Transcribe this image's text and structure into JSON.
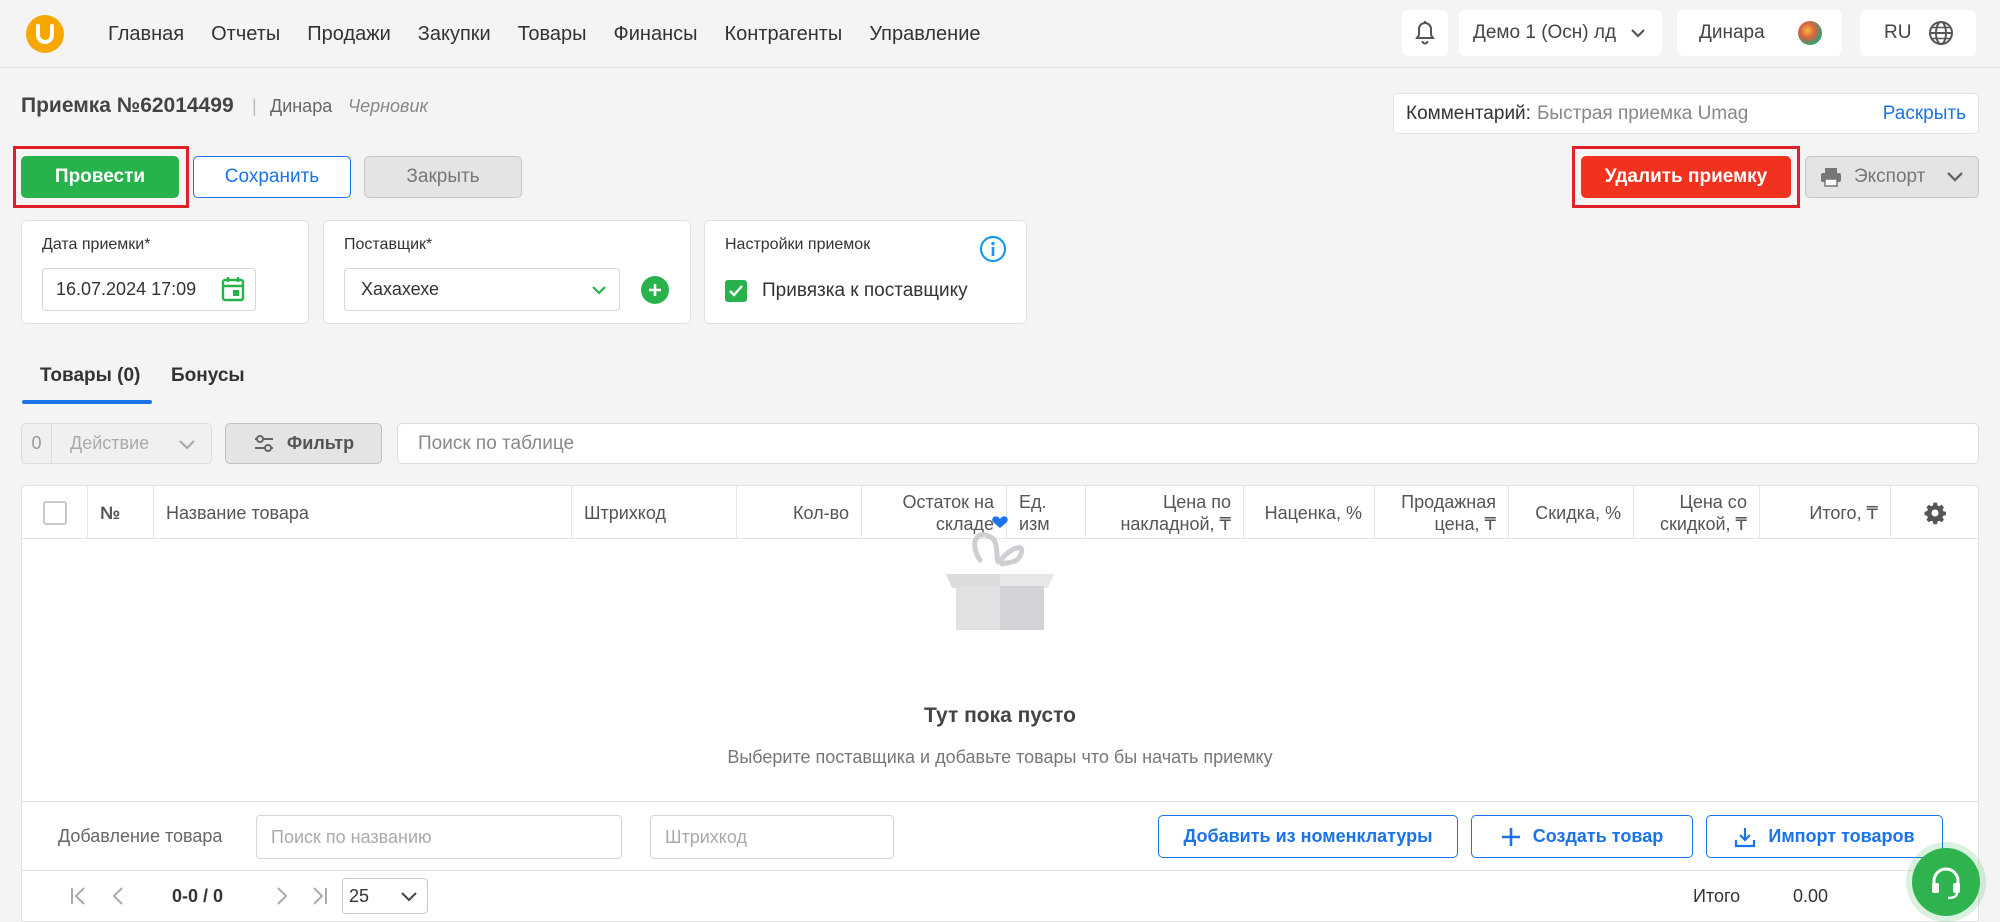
{
  "nav": {
    "items": [
      "Главная",
      "Отчеты",
      "Продажи",
      "Закупки",
      "Товары",
      "Финансы",
      "Контрагенты",
      "Управление"
    ],
    "store": "Демо 1 (Осн) лд",
    "user": "Динара",
    "language": "RU"
  },
  "header": {
    "title": "Приемка №62014499",
    "separator": "|",
    "author": "Динара",
    "status": "Черновик",
    "comment_label": "Комментарий:",
    "comment_value": "Быстрая приемка Umag",
    "comment_expand": "Раскрыть"
  },
  "actions": {
    "post": "Провести",
    "save": "Сохранить",
    "close": "Закрыть",
    "delete": "Удалить приемку",
    "export": "Экспорт"
  },
  "form": {
    "date_label": "Дата приемки*",
    "date_value": "16.07.2024 17:09",
    "supplier_label": "Поставщик*",
    "supplier_value": "Хахахехе",
    "settings_label": "Настройки приемок",
    "bind_supplier_label": "Привязка к поставщику",
    "bind_supplier_checked": true
  },
  "tabs": [
    "Товары (0)",
    "Бонусы"
  ],
  "toolbar": {
    "selected_count": "0",
    "action_label": "Действие",
    "filter_label": "Фильтр",
    "search_placeholder": "Поиск по таблице"
  },
  "table": {
    "columns": {
      "no": "№",
      "name": "Название товара",
      "barcode": "Штрихкод",
      "qty": "Кол-во",
      "stock_l1": "Остаток на",
      "stock_l2": "складе",
      "unit_l1": "Ед.",
      "unit_l2": "изм",
      "invoice_l1": "Цена по",
      "invoice_l2": "накладной, ₸",
      "markup": "Наценка, %",
      "sale_l1": "Продажная",
      "sale_l2": "цена, ₸",
      "discount": "Скидка, %",
      "disc_price_l1": "Цена со",
      "disc_price_l2": "скидкой, ₸",
      "total": "Итого, ₸"
    },
    "empty_title": "Тут пока пусто",
    "empty_subtitle": "Выберите поставщика и добавьте товары что бы начать приемку"
  },
  "add_product": {
    "label": "Добавление товара",
    "name_placeholder": "Поиск по названию",
    "barcode_placeholder": "Штрихкод",
    "from_catalog": "Добавить из номенклатуры",
    "create": "Создать товар",
    "import": "Импорт товаров"
  },
  "pagination": {
    "range": "0-0 / 0",
    "page_size": "25",
    "total_label": "Итого",
    "total_value": "0.00"
  },
  "colors": {
    "accent_blue": "#1a73e8",
    "success_green": "#28b24b",
    "danger_red": "#f0321e",
    "highlight_red": "#e0202a",
    "logo_orange": "#f7a700"
  }
}
